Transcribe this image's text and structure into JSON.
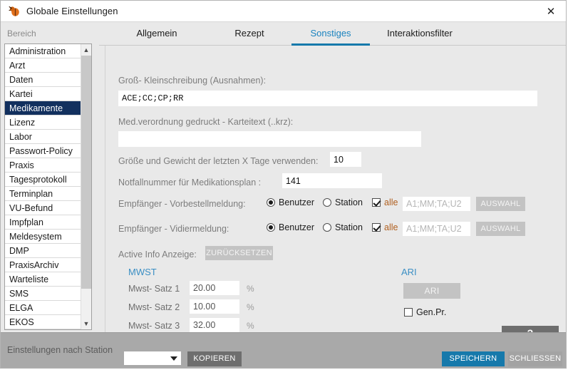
{
  "window": {
    "title": "Globale Einstellungen",
    "icon": "bug-icon",
    "close_icon": "close-icon"
  },
  "sidebar": {
    "header": "Bereich",
    "selected": "Medikamente",
    "scroll_up_icon": "chevron-up-icon",
    "scroll_down_icon": "chevron-down-icon",
    "items": [
      {
        "label": "Administration"
      },
      {
        "label": "Arzt"
      },
      {
        "label": "Daten"
      },
      {
        "label": "Kartei"
      },
      {
        "label": "Medikamente"
      },
      {
        "label": "Lizenz"
      },
      {
        "label": "Labor"
      },
      {
        "label": "Passwort-Policy"
      },
      {
        "label": "Praxis"
      },
      {
        "label": "Tagesprotokoll"
      },
      {
        "label": "Terminplan"
      },
      {
        "label": "VU-Befund"
      },
      {
        "label": "Impfplan"
      },
      {
        "label": "Meldesystem"
      },
      {
        "label": "DMP"
      },
      {
        "label": "PraxisArchiv"
      },
      {
        "label": "Warteliste"
      },
      {
        "label": "SMS"
      },
      {
        "label": "ELGA"
      },
      {
        "label": "EKOS"
      }
    ]
  },
  "tabs": [
    {
      "label": "Allgemein",
      "active": false
    },
    {
      "label": "Rezept",
      "active": false
    },
    {
      "label": "Sonstiges",
      "active": true
    },
    {
      "label": "Interaktionsfilter",
      "active": false
    }
  ],
  "form": {
    "case_label": "Groß- Kleinschreibung (Ausnahmen):",
    "case_value": "ACE;CC;CP;RR",
    "karteitext_label": "Med.verordnung gedruckt - Karteitext (..krz):",
    "karteitext_value": "",
    "size_weight_label": "Größe und Gewicht der letzten X Tage verwenden:",
    "size_weight_value": "10",
    "emergency_label": "Notfallnummer für Medikationsplan :",
    "emergency_value": "141",
    "recipient_pre_label": "Empfänger - Vorbestellmeldung:",
    "recipient_vid_label": "Empfänger - Vidiermeldung:",
    "radio_user": "Benutzer",
    "radio_station": "Station",
    "check_all": "alle",
    "recipient_placeholder": "A1;MM;TA;U2",
    "recipient_value": "",
    "auswahl_button": "AUSWAHL",
    "active_info_label": "Active Info Anzeige:",
    "reset_button": "ZURÜCKSETZEN"
  },
  "mwst": {
    "heading": "MWST",
    "rows": [
      {
        "label": "Mwst- Satz 1",
        "value": "20.00",
        "unit": "%"
      },
      {
        "label": "Mwst- Satz 2",
        "value": "10.00",
        "unit": "%"
      },
      {
        "label": "Mwst- Satz 3",
        "value": "32.00",
        "unit": "%"
      }
    ]
  },
  "ari": {
    "heading": "ARI",
    "button": "ARI",
    "checkbox_label": "Gen.Pr.",
    "checkbox_checked": false
  },
  "help": {
    "label": "?"
  },
  "footer": {
    "copy_label": "Einstellungen nach Station",
    "station_value": "",
    "copy_button": "KOPIEREN",
    "save_button": "SPEICHERN",
    "close_button": "SCHLIESSEN"
  },
  "colors": {
    "accent": "#1679ab",
    "tab_active": "#1b83bf",
    "selection": "#12305e",
    "section_heading": "#3b8fc4",
    "checkbox_label": "#b06020",
    "footer_bar": "#a9a9a9"
  }
}
